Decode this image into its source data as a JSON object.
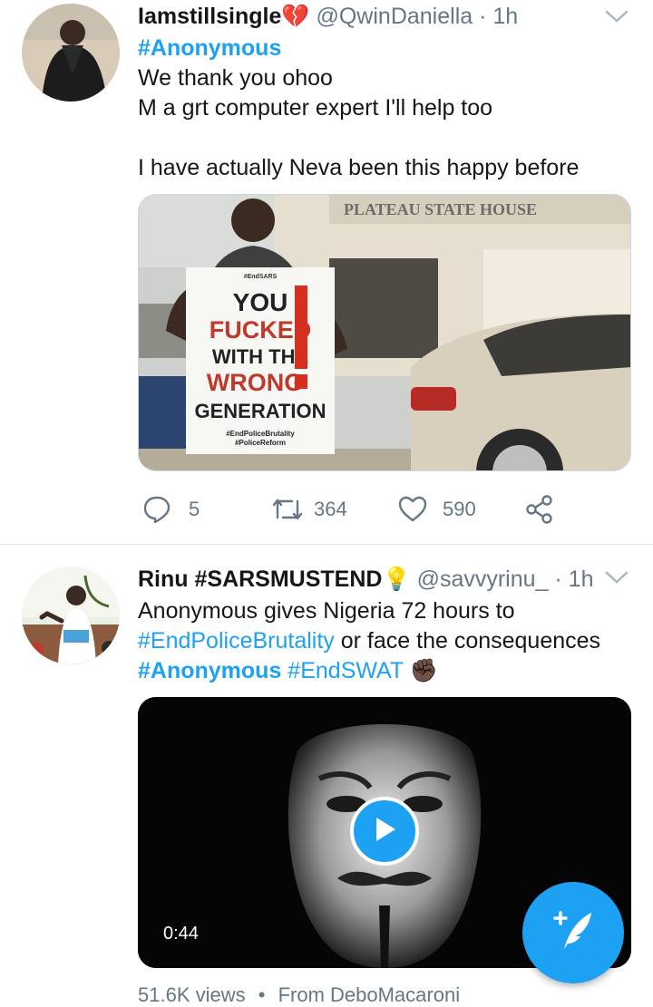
{
  "tweet1": {
    "display_name": "Iamstillsingle",
    "name_glyph": "💔",
    "handle": "@QwinDaniella",
    "time": "· 1h",
    "hashtag": "#Anonymous",
    "line1": "We thank you ohoo",
    "line2": "M a grt computer expert I'll help too",
    "line3": "I have actually Neva been this happy before",
    "image": {
      "building_sign": "PLATEAU STATE HOUSE",
      "sign_small": "#EndSARS",
      "sign_you": "YOU",
      "sign_fucked": "FUCKED",
      "sign_with": "WITH THE",
      "sign_wrong": "WRONG",
      "sign_generation": "GENERATION",
      "sign_tag1": "#EndPoliceBrutality",
      "sign_tag2": "#PoliceReform"
    },
    "replies": "5",
    "retweets": "364",
    "likes": "590"
  },
  "tweet2": {
    "display_name": "Rinu #SARSMUSTEND",
    "name_glyph": "💡",
    "handle": "@savvyrinu_",
    "time": "· 1h",
    "line1": "Anonymous gives Nigeria 72 hours to",
    "line2_tag": "#EndPoliceBrutality",
    "line2_rest": " or face the consequences",
    "line3_tag1": "#Anonymous",
    "line3_tag2": " #EndSWAT",
    "line3_emoji": "✊🏿",
    "video_duration": "0:44",
    "views": "51.6K views",
    "dot": "•",
    "from": "From DeboMacaroni"
  },
  "colors": {
    "accent": "#1da1f2",
    "secondary_text": "#657786"
  },
  "icons": [
    "chevron-down-icon",
    "reply-icon",
    "retweet-icon",
    "like-icon",
    "share-icon",
    "play-icon",
    "compose-tweet-icon"
  ]
}
